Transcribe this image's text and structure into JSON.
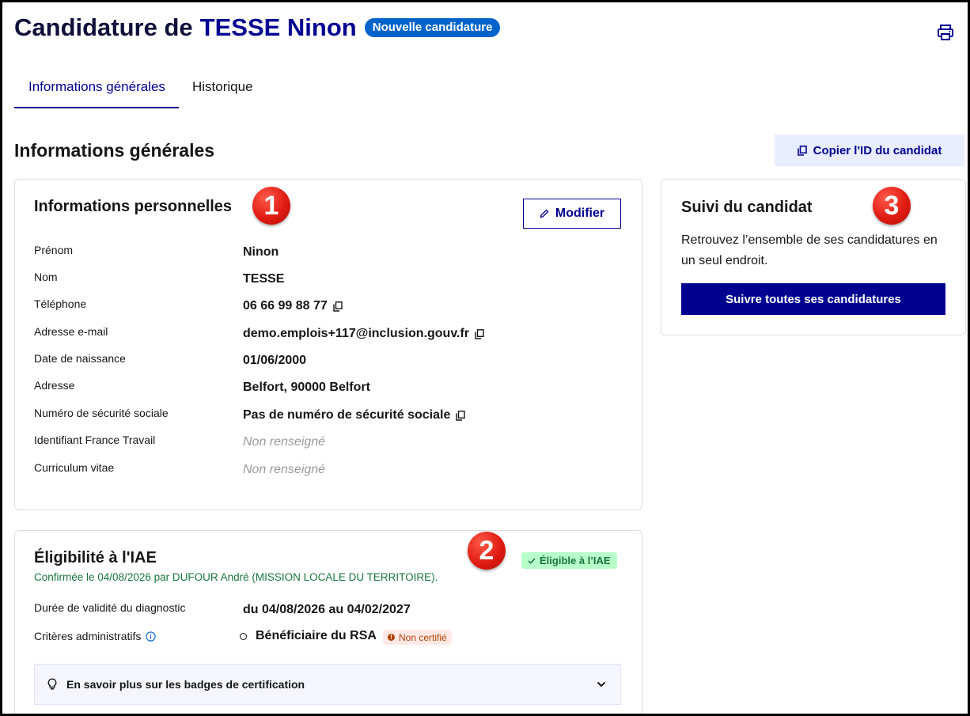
{
  "header": {
    "title_prefix": "Candidature de",
    "candidate_name": "TESSE Ninon",
    "status_badge": "Nouvelle candidature"
  },
  "tabs": [
    {
      "label": "Informations générales",
      "active": true
    },
    {
      "label": "Historique",
      "active": false
    }
  ],
  "section_title": "Informations générales",
  "copy_id_label": "Copier l'ID du candidat",
  "personal": {
    "title": "Informations personnelles",
    "badge": "1",
    "modify_label": "Modifier",
    "rows": [
      {
        "label": "Prénom",
        "value": "Ninon"
      },
      {
        "label": "Nom",
        "value": "TESSE"
      },
      {
        "label": "Téléphone",
        "value": "06 66 99 88 77"
      },
      {
        "label": "Adresse e-mail",
        "value": "demo.emplois+117@inclusion.gouv.fr"
      },
      {
        "label": "Date de naissance",
        "value": "01/06/2000"
      },
      {
        "label": "Adresse",
        "value": "Belfort, 90000 Belfort"
      },
      {
        "label": "Numéro de sécurité sociale",
        "value": "Pas de numéro de sécurité sociale"
      },
      {
        "label": "Identifiant France Travail",
        "value": "Non renseigné"
      },
      {
        "label": "Curriculum vitae",
        "value": "Non renseigné"
      }
    ]
  },
  "follow": {
    "title": "Suivi du candidat",
    "badge": "3",
    "text": "Retrouvez l’ensemble de ses candidatures en un seul endroit.",
    "button_label": "Suivre toutes ses candidatures"
  },
  "eligibility": {
    "title": "Éligibilité à l'IAE",
    "badge": "2",
    "status": "Éligible à l’IAE",
    "confirmation": "Confirmée le 04/08/2026 par DUFOUR André (MISSION LOCALE DU TERRITOIRE).",
    "validity_label": "Durée de validité du diagnostic",
    "validity_value": "du 04/08/2026 au 04/02/2027",
    "criteria_label": "Critères administratifs",
    "criteria_value": "Bénéficiaire du RSA",
    "criteria_badge": "Non certifié",
    "accordion_label": "En savoir plus sur les badges de certification"
  },
  "colors": {
    "primary": "#000091",
    "badge_blue": "#0063cb",
    "success": "#18753c",
    "warning": "#b34000",
    "marker_red": "#e01b12"
  }
}
